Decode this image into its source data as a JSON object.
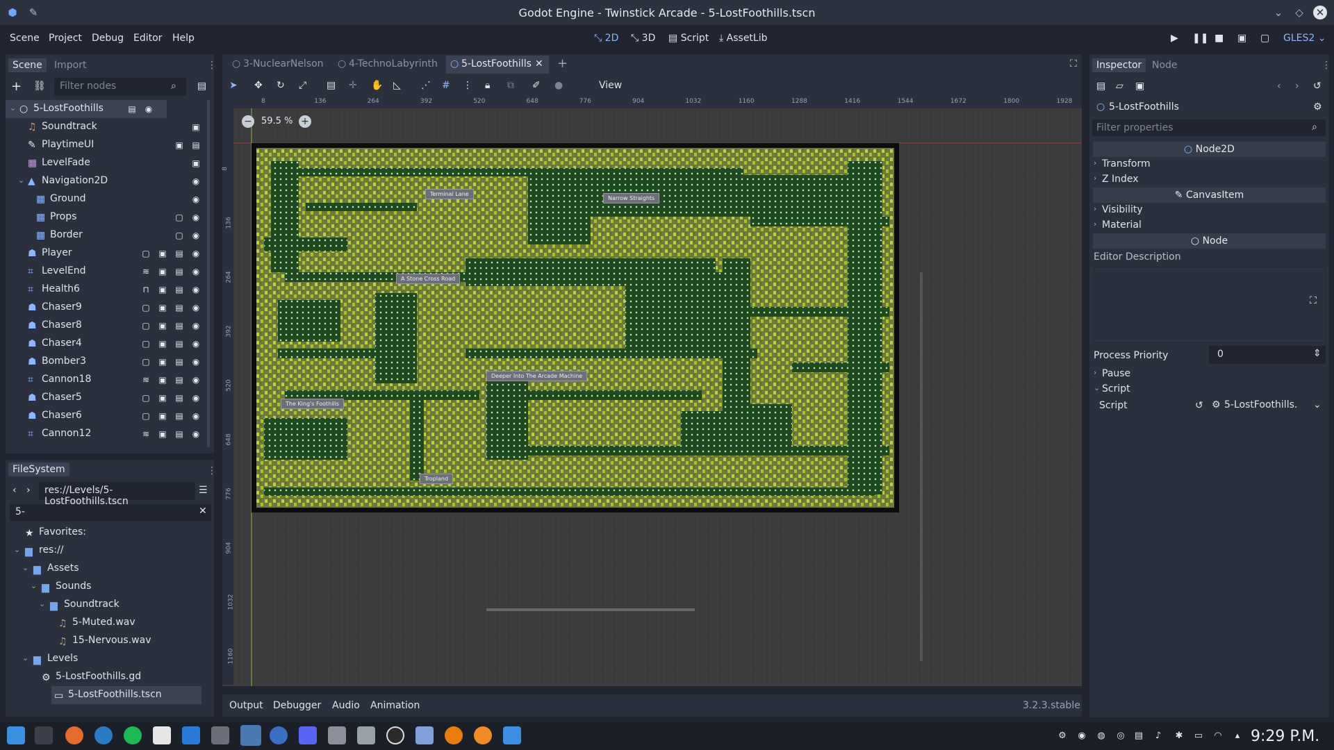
{
  "window": {
    "title": "Godot Engine - Twinstick Arcade - 5-LostFoothills.tscn"
  },
  "menu": [
    "Scene",
    "Project",
    "Debug",
    "Editor",
    "Help"
  ],
  "workspaces": [
    {
      "label": "2D",
      "icon": "2d-icon"
    },
    {
      "label": "3D",
      "icon": "3d-icon"
    },
    {
      "label": "Script",
      "icon": "script-icon"
    },
    {
      "label": "AssetLib",
      "icon": "download-icon"
    }
  ],
  "renderer": "GLES2",
  "scene_dock": {
    "tabs": [
      "Scene",
      "Import"
    ],
    "filter_placeholder": "Filter nodes",
    "nodes": [
      {
        "name": "5-LostFoothills",
        "depth": 0,
        "icon": "node-icon"
      },
      {
        "name": "Soundtrack",
        "depth": 1,
        "icon": "audio-icon"
      },
      {
        "name": "PlaytimeUI",
        "depth": 1,
        "icon": "ui-icon"
      },
      {
        "name": "LevelFade",
        "depth": 1,
        "icon": "fade-icon"
      },
      {
        "name": "Navigation2D",
        "depth": 1,
        "icon": "navigation-icon"
      },
      {
        "name": "Ground",
        "depth": 2,
        "icon": "tilemap-icon"
      },
      {
        "name": "Props",
        "depth": 2,
        "icon": "tilemap-icon"
      },
      {
        "name": "Border",
        "depth": 2,
        "icon": "tilemap-icon"
      },
      {
        "name": "Player",
        "depth": 1,
        "icon": "character-icon"
      },
      {
        "name": "LevelEnd",
        "depth": 1,
        "icon": "area-icon"
      },
      {
        "name": "Health6",
        "depth": 1,
        "icon": "area-icon"
      },
      {
        "name": "Chaser9",
        "depth": 1,
        "icon": "character-icon"
      },
      {
        "name": "Chaser8",
        "depth": 1,
        "icon": "character-icon"
      },
      {
        "name": "Chaser4",
        "depth": 1,
        "icon": "character-icon"
      },
      {
        "name": "Bomber3",
        "depth": 1,
        "icon": "character-icon"
      },
      {
        "name": "Cannon18",
        "depth": 1,
        "icon": "area-icon"
      },
      {
        "name": "Chaser5",
        "depth": 1,
        "icon": "character-icon"
      },
      {
        "name": "Chaser6",
        "depth": 1,
        "icon": "character-icon"
      },
      {
        "name": "Cannon12",
        "depth": 1,
        "icon": "area-icon"
      }
    ]
  },
  "filesystem": {
    "tab": "FileSystem",
    "path": "res://Levels/5-LostFoothills.tscn",
    "search": "5-",
    "items": [
      {
        "name": "Favorites:",
        "depth": 0,
        "icon": "star-icon"
      },
      {
        "name": "res://",
        "depth": 0,
        "icon": "folder-icon"
      },
      {
        "name": "Assets",
        "depth": 1,
        "icon": "folder-icon"
      },
      {
        "name": "Sounds",
        "depth": 2,
        "icon": "folder-icon"
      },
      {
        "name": "Soundtrack",
        "depth": 3,
        "icon": "folder-icon"
      },
      {
        "name": "5-Muted.wav",
        "depth": 4,
        "icon": "audio-file-icon"
      },
      {
        "name": "15-Nervous.wav",
        "depth": 4,
        "icon": "audio-file-icon"
      },
      {
        "name": "Levels",
        "depth": 1,
        "icon": "folder-icon"
      },
      {
        "name": "5-LostFoothills.gd",
        "depth": 2,
        "icon": "gear-icon"
      },
      {
        "name": "5-LostFoothills.tscn",
        "depth": 2,
        "icon": "scene-file-icon"
      }
    ]
  },
  "scene_tabs": [
    "3-NuclearNelson",
    "4-TechnoLabyrinth",
    "5-LostFoothills"
  ],
  "viewport": {
    "toolbar_view": "View",
    "zoom": "59.5 %",
    "ruler_x": [
      "8",
      "136",
      "264",
      "392",
      "520",
      "648",
      "776",
      "904",
      "1032",
      "1160",
      "1288",
      "1416",
      "1544",
      "1672",
      "1800",
      "1928"
    ],
    "ruler_y": [
      "8",
      "136",
      "264",
      "392",
      "520",
      "648",
      "776",
      "904",
      "1032",
      "1160"
    ],
    "map_labels": [
      "Terminal Lane",
      "Narrow Straights",
      "A Stone Cross Road",
      "Deeper Into The Arcade Machine",
      "The King's Foothills",
      "Tropland"
    ]
  },
  "bottom_panel": {
    "tabs": [
      "Output",
      "Debugger",
      "Audio",
      "Animation"
    ],
    "version": "3.2.3.stable"
  },
  "inspector": {
    "tabs": [
      "Inspector",
      "Node"
    ],
    "node_name": "5-LostFoothills",
    "filter_placeholder": "Filter properties",
    "sections": {
      "node2d": "Node2D",
      "transform": "Transform",
      "z_index": "Z Index",
      "canvas_item": "CanvasItem",
      "visibility": "Visibility",
      "material": "Material",
      "node": "Node",
      "editor_description": "Editor Description",
      "process_priority_label": "Process Priority",
      "process_priority_value": "0",
      "pause": "Pause",
      "script": "Script",
      "script_label": "Script",
      "script_value": "5-LostFoothills."
    }
  },
  "taskbar": {
    "clock": "9:29 P.M."
  },
  "colors": {
    "accent": "#8eb6ff",
    "bg": "#202531",
    "panel": "#2a303d",
    "map_green": "#1e4a1e",
    "map_lime": "#9dba2e"
  }
}
